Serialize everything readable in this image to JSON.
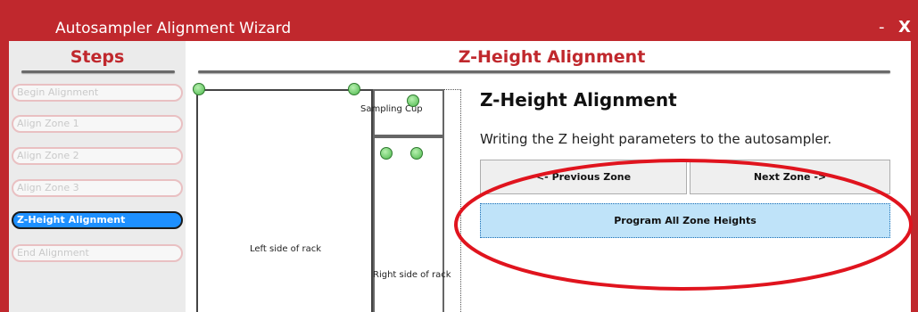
{
  "window": {
    "title": "Autosampler Alignment Wizard",
    "minimize_glyph": "-",
    "close_glyph": "X",
    "accent_color": "#c0282d"
  },
  "sidebar": {
    "title": "Steps",
    "items": [
      {
        "label": "Begin Alignment",
        "active": false
      },
      {
        "label": "Align Zone 1",
        "active": false
      },
      {
        "label": "Align Zone 2",
        "active": false
      },
      {
        "label": "Align Zone 3",
        "active": false
      },
      {
        "label": "Z-Height Alignment",
        "active": true
      },
      {
        "label": "End Alignment",
        "active": false
      }
    ]
  },
  "main": {
    "title": "Z-Height Alignment",
    "rack": {
      "cup_label": "Sampling Cup",
      "left_label": "Left side of rack",
      "right_label": "Right side of rack"
    },
    "panel": {
      "heading": "Z-Height Alignment",
      "description": "Writing the Z height parameters to the autosampler.",
      "prev_label": "<- Previous Zone",
      "next_label": "Next Zone ->",
      "program_label": "Program All Zone Heights"
    }
  },
  "colors": {
    "active_step": "#1e90ff",
    "program_button": "#bfe3f9",
    "annotation_ellipse": "#e0141e",
    "marker_green": "#4cb84c"
  }
}
